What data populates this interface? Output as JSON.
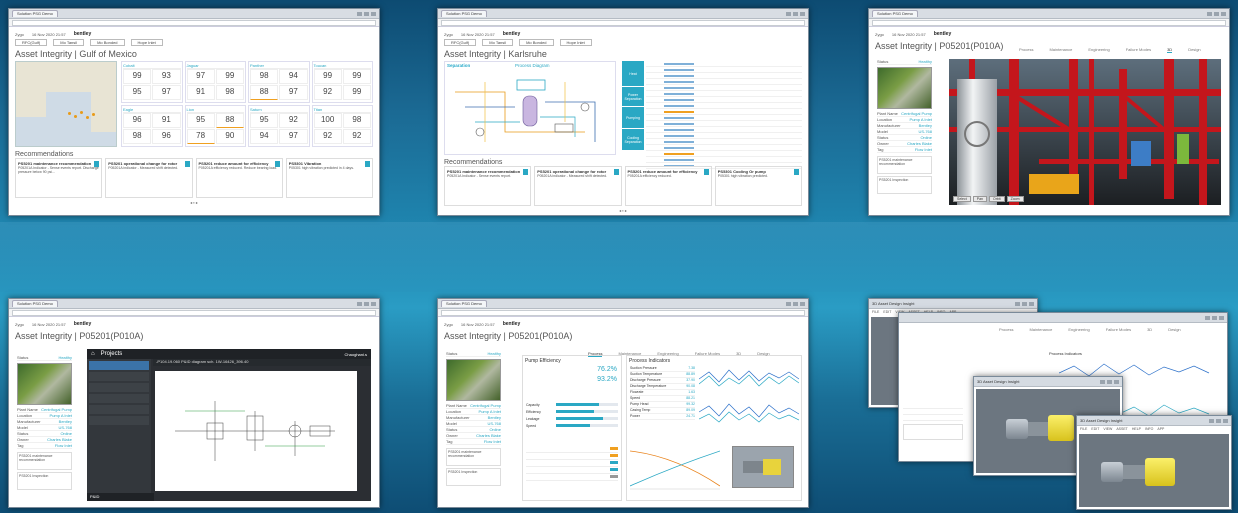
{
  "common": {
    "tab_label": "Solution PSG Demo",
    "user": "Zygo",
    "date": "16 Nov 2020 21:57",
    "app_brand": "bentley",
    "filter_region": "RFC(Gulf)",
    "filter_asset": "Mo Tansil",
    "filter_comp": "Mo Bonded",
    "filter_aggregate": "Hope Inlet"
  },
  "w1": {
    "title_prefix": "Asset Integrity",
    "title_site": "Gulf of Mexico",
    "groups": [
      {
        "name": "Cobalt",
        "vals": [
          "99",
          "93",
          "95",
          "97"
        ]
      },
      {
        "name": "Jaguar",
        "vals": [
          "97",
          "99",
          "91",
          "98"
        ]
      },
      {
        "name": "Panther",
        "vals": [
          "98",
          "94",
          "88",
          "97"
        ]
      },
      {
        "name": "Toucan",
        "vals": [
          "99",
          "99",
          "92",
          "99"
        ]
      },
      {
        "name": "Eagle",
        "vals": [
          "96",
          "91",
          "98",
          "96"
        ]
      },
      {
        "name": "Lion",
        "vals": [
          "95",
          "88",
          "78",
          "90"
        ]
      },
      {
        "name": "Saturn",
        "vals": [
          "95",
          "92",
          "94",
          "97"
        ]
      },
      {
        "name": "Titan",
        "vals": [
          "100",
          "98",
          "92",
          "92"
        ]
      }
    ],
    "recs_title": "Recommendations",
    "recs": [
      {
        "head": "PS5201 maintenance recommendation",
        "body": "P05201A Indicator - Sense events report. Discharge pressure below 90 psi..."
      },
      {
        "head": "PS5201 operational change for rotor",
        "body": "P05201A indicator - Measured shift detected."
      },
      {
        "head": "PS5201 reduce amount for efficiency",
        "body": "P05201A efficiency reduced. Reduce bearing load."
      },
      {
        "head": "PS5301 Vibration",
        "body": "P05301 high vibration predicted in 4 days."
      }
    ]
  },
  "w2": {
    "title_prefix": "Asset Integrity",
    "title_site": "Karlsruhe",
    "diagram_title": "Process Diagram",
    "diagram_label": "Separation",
    "table_groups": [
      "Heat",
      "Power Separation",
      "Pumping",
      "Cooling Separation"
    ],
    "recs_title": "Recommendations",
    "recs": [
      {
        "head": "PS5201 maintenance recommendation",
        "body": "P05201A Indicator - Sense events report."
      },
      {
        "head": "PS5201 operational change for rotor",
        "body": "P05201A indicator - Measured shift detected."
      },
      {
        "head": "PS5201 reduce amount for efficiency",
        "body": "P05201A efficiency reduced."
      },
      {
        "head": "PS5301 Cooling Or pump",
        "body": "P05301 high vibration predicted."
      }
    ]
  },
  "w3": {
    "title": "Asset Integrity | P05201(P010A)",
    "tabs": [
      "Process",
      "Maintenance",
      "Engineering",
      "Failure Modes",
      "3D",
      "Design"
    ],
    "active_tab": "3D",
    "side_label": "Status",
    "side_value": "Healthy",
    "rows": [
      [
        "Plant Name",
        "Centrifugal Pump"
      ],
      [
        "Location",
        "Pump A Inlet"
      ],
      [
        "Manufacturer",
        "Bentley"
      ],
      [
        "Model",
        "US-768"
      ],
      [
        "Status",
        "Online"
      ],
      [
        "Owner",
        "Charles Blake"
      ],
      [
        "Tag",
        "Flow Inlet"
      ]
    ],
    "rec_head": "PS5201 maintenance recommendation",
    "inspection_head": "PS5201 Inspection",
    "view_buttons": [
      "Select",
      "Pan",
      "Orbit",
      "Zoom"
    ]
  },
  "w4": {
    "title": "Asset Integrity | P05201(P010A)",
    "projects_label": "Projects",
    "diagram_path": "-P104.19.060 P&ID diagram sch. 1W-16426_396.40",
    "active_tab": "Engineering",
    "panel_foot": "P&ID",
    "user": "Chaoghani.s",
    "side_label": "Status",
    "side_value": "Healthy",
    "rows": [
      [
        "Plant Name",
        "Centrifugal Pump"
      ],
      [
        "Location",
        "Pump A Inlet"
      ],
      [
        "Manufacturer",
        "Bentley"
      ],
      [
        "Model",
        "US-768"
      ],
      [
        "Status",
        "Online"
      ],
      [
        "Owner",
        "Charles Blake"
      ],
      [
        "Tag",
        "Flow Inlet"
      ]
    ],
    "rec_head": "PS5201 maintenance recommendation",
    "inspection_head": "PS5201 Inspection"
  },
  "w5": {
    "title": "Asset Integrity | P05201(P010A)",
    "active_tab": "Process",
    "pump_eff_title": "Pump Efficiency",
    "process_title": "Process Indicators",
    "eff_value": "76.2%",
    "eff_value2": "93.2%",
    "bars": [
      [
        "Capacity",
        0.7
      ],
      [
        "Efficiency",
        0.62
      ],
      [
        "Leakage",
        0.75
      ],
      [
        "Speed",
        0.55
      ]
    ],
    "indicators": [
      [
        "Suction Pressure",
        "7.38"
      ],
      [
        "Suction Temperature",
        "88.89"
      ],
      [
        "Discharge Pressure",
        "37.90"
      ],
      [
        "Discharge Temperature",
        "90.08"
      ],
      [
        "Flowrate",
        "1.63"
      ],
      [
        "Speed",
        "88.21"
      ],
      [
        "Pump Head",
        "99.32"
      ],
      [
        "Casing Temp",
        "89.09"
      ],
      [
        "Power",
        "24.71"
      ]
    ],
    "side_label": "Status",
    "side_value": "Healthy",
    "rows": [
      [
        "Plant Name",
        "Centrifugal Pump"
      ],
      [
        "Location",
        "Pump A Inlet"
      ],
      [
        "Manufacturer",
        "Bentley"
      ],
      [
        "Model",
        "US-768"
      ],
      [
        "Status",
        "Online"
      ],
      [
        "Owner",
        "Charles Blake"
      ],
      [
        "Tag",
        "Flow Inlet"
      ]
    ],
    "rec_head": "PS5201 maintenance recommendation",
    "inspection_head": "PS5201 Inspection"
  },
  "w6": {
    "title": "3D Asset Design Insight",
    "menu": [
      "FILE",
      "EDIT",
      "VIEW",
      "ASSET",
      "HELP",
      "INFO",
      "APP"
    ],
    "tabs": [
      "Process",
      "Maintenance",
      "Engineering",
      "Failure Modes",
      "3D",
      "Design"
    ],
    "process_title": "Process Indicators"
  }
}
